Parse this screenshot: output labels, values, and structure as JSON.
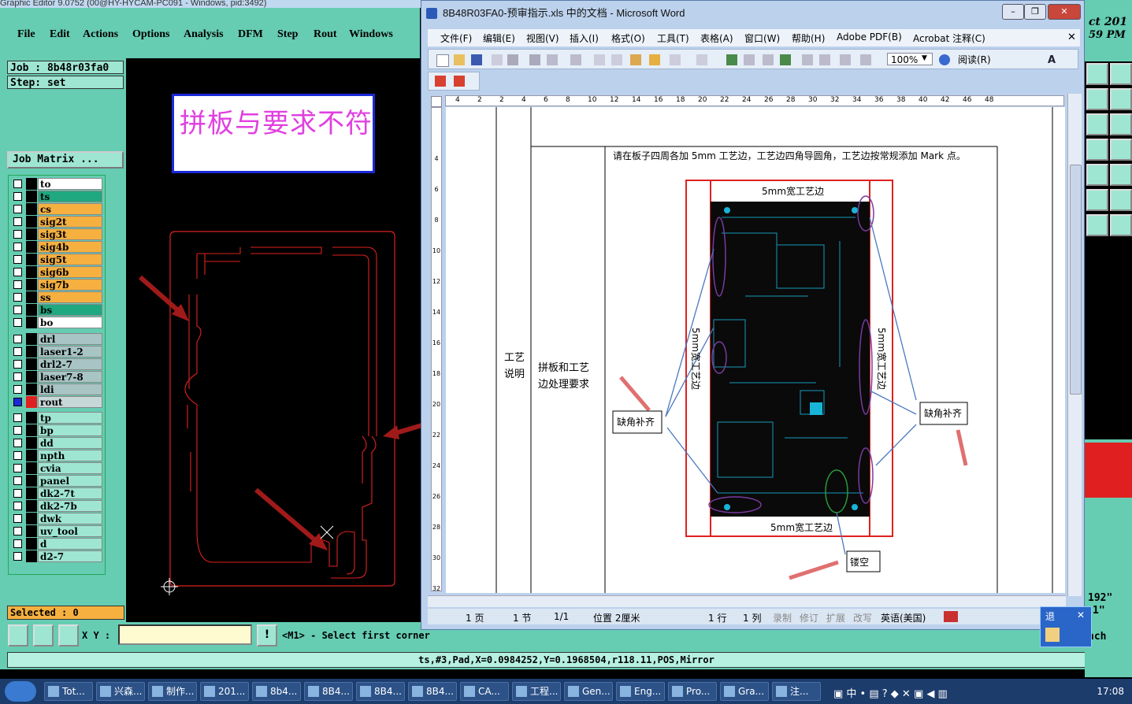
{
  "genesis": {
    "title": "Graphic Editor 9.0752 (00@HY-HYCAM-PC091 - Windows, pid:3492)",
    "menu": [
      "File",
      "Edit",
      "Actions",
      "Options",
      "Analysis",
      "DFM",
      "Step",
      "Rout",
      "Windows"
    ],
    "job_label": "Job : 8b48r03fa0",
    "step_label": "Step: set",
    "job_matrix": "Job Matrix ...",
    "layers_group1": [
      {
        "name": "to",
        "color": "#ffffff"
      },
      {
        "name": "ts",
        "color": "#20a880"
      },
      {
        "name": "cs",
        "color": "#f5b040"
      },
      {
        "name": "sig2t",
        "color": "#f5b040"
      },
      {
        "name": "sig3t",
        "color": "#f5b040"
      },
      {
        "name": "sig4b",
        "color": "#f5b040"
      },
      {
        "name": "sig5t",
        "color": "#f5b040"
      },
      {
        "name": "sig6b",
        "color": "#f5b040"
      },
      {
        "name": "sig7b",
        "color": "#f5b040"
      },
      {
        "name": "ss",
        "color": "#f5b040"
      },
      {
        "name": "bs",
        "color": "#20a880"
      },
      {
        "name": "bo",
        "color": "#ffffff"
      }
    ],
    "layers_group2": [
      {
        "name": "drl",
        "color": "#a8c4c4"
      },
      {
        "name": "laser1-2",
        "color": "#a8c4c4"
      },
      {
        "name": "drl2-7",
        "color": "#a8c4c4"
      },
      {
        "name": "laser7-8",
        "color": "#a8c4c4"
      },
      {
        "name": "ldi",
        "color": "#a8c4c4"
      },
      {
        "name": "rout",
        "color": "#c8d8d8"
      }
    ],
    "layers_group3": [
      {
        "name": "tp",
        "color": "#9fe6d2"
      },
      {
        "name": "bp",
        "color": "#9fe6d2"
      },
      {
        "name": "dd",
        "color": "#9fe6d2"
      },
      {
        "name": "npth",
        "color": "#9fe6d2"
      },
      {
        "name": "cvia",
        "color": "#9fe6d2"
      },
      {
        "name": "panel",
        "color": "#9fe6d2"
      },
      {
        "name": "dk2-7t",
        "color": "#9fe6d2"
      },
      {
        "name": "dk2-7b",
        "color": "#9fe6d2"
      },
      {
        "name": "dwk",
        "color": "#9fe6d2"
      },
      {
        "name": "uv_tool",
        "color": "#9fe6d2"
      },
      {
        "name": "d",
        "color": "#9fe6d2"
      },
      {
        "name": "d2-7",
        "color": "#9fe6d2"
      }
    ],
    "selected": "Selected : 0",
    "xy_label": "X Y :",
    "xy_value": "",
    "prompt": "<M1> - Select first corner",
    "status": "ts,#3,Pad,X=0.0984252,Y=0.1968504,r118.11,POS,Mirror",
    "warning_text": "拼板与要求不符"
  },
  "word": {
    "title": "8B48R03FA0-预审指示.xls 中的文档 - Microsoft Word",
    "menu": [
      "文件(F)",
      "编辑(E)",
      "视图(V)",
      "插入(I)",
      "格式(O)",
      "工具(T)",
      "表格(A)",
      "窗口(W)",
      "帮助(H)",
      "Adobe PDF(B)",
      "Acrobat 注释(C)"
    ],
    "zoom": "100%",
    "read_mode": "阅读(R)",
    "ruler_h": [
      "4",
      "2",
      "2",
      "4",
      "6",
      "8",
      "10",
      "12",
      "14",
      "16",
      "18",
      "20",
      "22",
      "24",
      "26",
      "28",
      "30",
      "32",
      "34",
      "36",
      "38",
      "40",
      "42",
      "46",
      "48"
    ],
    "ruler_v": [
      "4",
      "6",
      "8",
      "10",
      "12",
      "14",
      "16",
      "18",
      "20",
      "22",
      "24",
      "26",
      "28",
      "30",
      "32"
    ],
    "cell_section": "工艺\n说明",
    "cell_item": "拼板和工艺\n边处理要求",
    "cell_text": "请在板子四周各加 5mm 工艺边，工艺边四角导圆角，工艺边按常规添加 Mark 点。",
    "fig_top": "5mm宽工艺边",
    "fig_bottom": "5mm宽工艺边",
    "fig_left": "5mm宽工艺边",
    "fig_right": "5mm宽工艺边",
    "fig_note_left": "缺角补齐",
    "fig_note_right": "缺角补齐",
    "fig_note_bottom": "镂空",
    "status": {
      "page": "1 页",
      "section": "1 节",
      "pages": "1/1",
      "position": "位置 2厘米",
      "line": "1 行",
      "col": "1 列",
      "rec": "录制",
      "trk": "修订",
      "ext": "扩展",
      "ovr": "改写",
      "lang": "英语(美国)"
    }
  },
  "right_app": {
    "title_fragment": "ct 201",
    "time_fragment": "59 PM",
    "value1": "192\"",
    "value2": "1\"",
    "value3": "nch"
  },
  "ime": {
    "label": "退"
  },
  "taskbar": {
    "items": [
      "Tot...",
      "兴森...",
      "制作...",
      "201...",
      "8b4...",
      "8B4...",
      "8B4...",
      "8B4...",
      "CA...",
      "工程...",
      "Gen...",
      "Eng...",
      "Pro...",
      "Gra...",
      "注..."
    ],
    "clock": "17:08"
  },
  "colors": {
    "genesis_bg": "#66ccb2",
    "rout_line": "#e02020",
    "warning_text": "#e040e0",
    "pcb_bg": "#0a0a0a",
    "pcb_trace": "#18b4d8"
  }
}
